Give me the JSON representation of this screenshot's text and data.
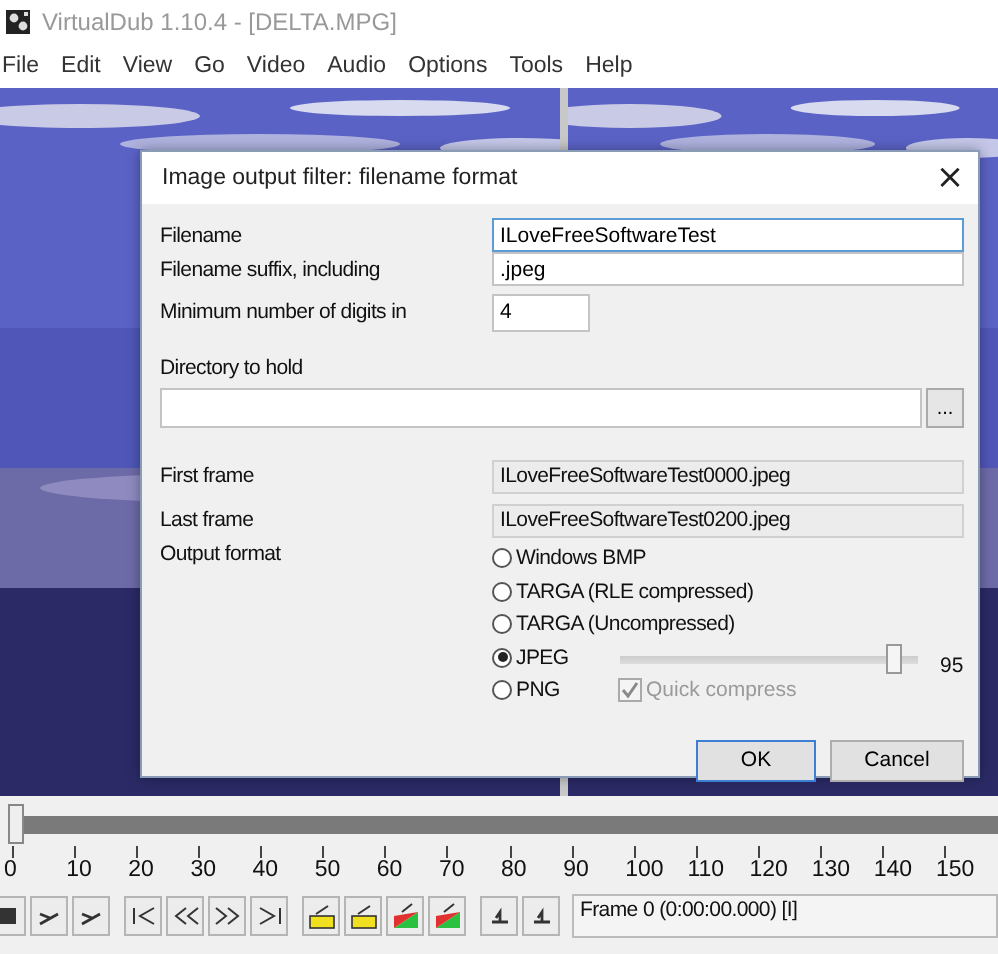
{
  "window": {
    "title": "VirtualDub 1.10.4 - [DELTA.MPG]"
  },
  "menu": [
    "File",
    "Edit",
    "View",
    "Go",
    "Video",
    "Audio",
    "Options",
    "Tools",
    "Help"
  ],
  "dialog": {
    "title": "Image output filter: filename format",
    "close": "×",
    "filename": {
      "label": "Filename",
      "value": "ILoveFreeSoftwareTest"
    },
    "suffix": {
      "label": "Filename suffix, including",
      "value": ".jpeg"
    },
    "digits": {
      "label": "Minimum number of digits in",
      "value": "4"
    },
    "directory": {
      "label": "Directory to hold",
      "browse": "..."
    },
    "first_frame": {
      "label": "First frame",
      "value": "ILoveFreeSoftwareTest0000.jpeg"
    },
    "last_frame": {
      "label": "Last frame",
      "value": "ILoveFreeSoftwareTest0200.jpeg"
    },
    "output_format": {
      "label": "Output format",
      "options": [
        {
          "label": "Windows BMP",
          "selected": false
        },
        {
          "label": "TARGA (RLE compressed)",
          "selected": false
        },
        {
          "label": "TARGA (Uncompressed)",
          "selected": false
        },
        {
          "label": "JPEG",
          "selected": true
        },
        {
          "label": "PNG",
          "selected": false
        }
      ]
    },
    "quality": {
      "level": 0.92,
      "reading": "95"
    },
    "quick_compress": {
      "label": "Quick compress",
      "checked": true,
      "disabled": true
    },
    "buttons": [
      "OK",
      "Cancel"
    ]
  },
  "timeline": {
    "level": 0,
    "ticks": [
      "0",
      "10",
      "20",
      "30",
      "40",
      "50",
      "60",
      "70",
      "80",
      "90",
      "100",
      "110",
      "120",
      "130",
      "140",
      "150"
    ]
  },
  "status": {
    "frame": "Frame 0 (0:00:00.000) [I]"
  }
}
